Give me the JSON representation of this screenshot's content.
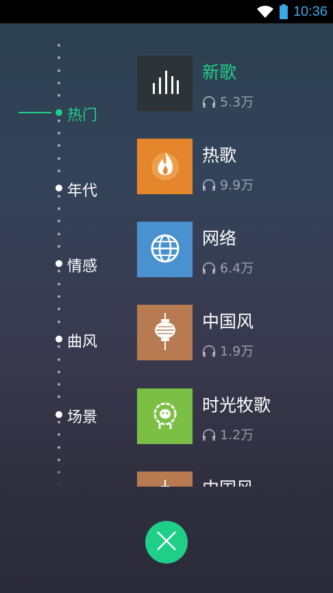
{
  "status": {
    "time": "10:36"
  },
  "timeline": {
    "labels": [
      {
        "text": "热门",
        "active": true
      },
      {
        "text": "年代",
        "active": false
      },
      {
        "text": "情感",
        "active": false
      },
      {
        "text": "曲风",
        "active": false
      },
      {
        "text": "场景",
        "active": false
      }
    ]
  },
  "items": [
    {
      "title": "新歌",
      "plays": "5.3万",
      "active": true,
      "icon": "equalizer-bars-icon",
      "color": "#2d3438"
    },
    {
      "title": "热歌",
      "plays": "9.9万",
      "active": false,
      "icon": "flame-icon",
      "color": "#e5852c"
    },
    {
      "title": "网络",
      "plays": "6.4万",
      "active": false,
      "icon": "globe-icon",
      "color": "#4a92cf"
    },
    {
      "title": "中国风",
      "plays": "1.9万",
      "active": false,
      "icon": "lantern-icon",
      "color": "#b87a50"
    },
    {
      "title": "时光牧歌",
      "plays": "1.2万",
      "active": false,
      "icon": "sheep-icon",
      "color": "#7bbf45"
    },
    {
      "title": "中国风",
      "plays": "",
      "active": false,
      "icon": "lantern-icon",
      "color": "#b87a50"
    }
  ],
  "close_button": {
    "icon": "close-icon",
    "color": "#1fcf88"
  }
}
